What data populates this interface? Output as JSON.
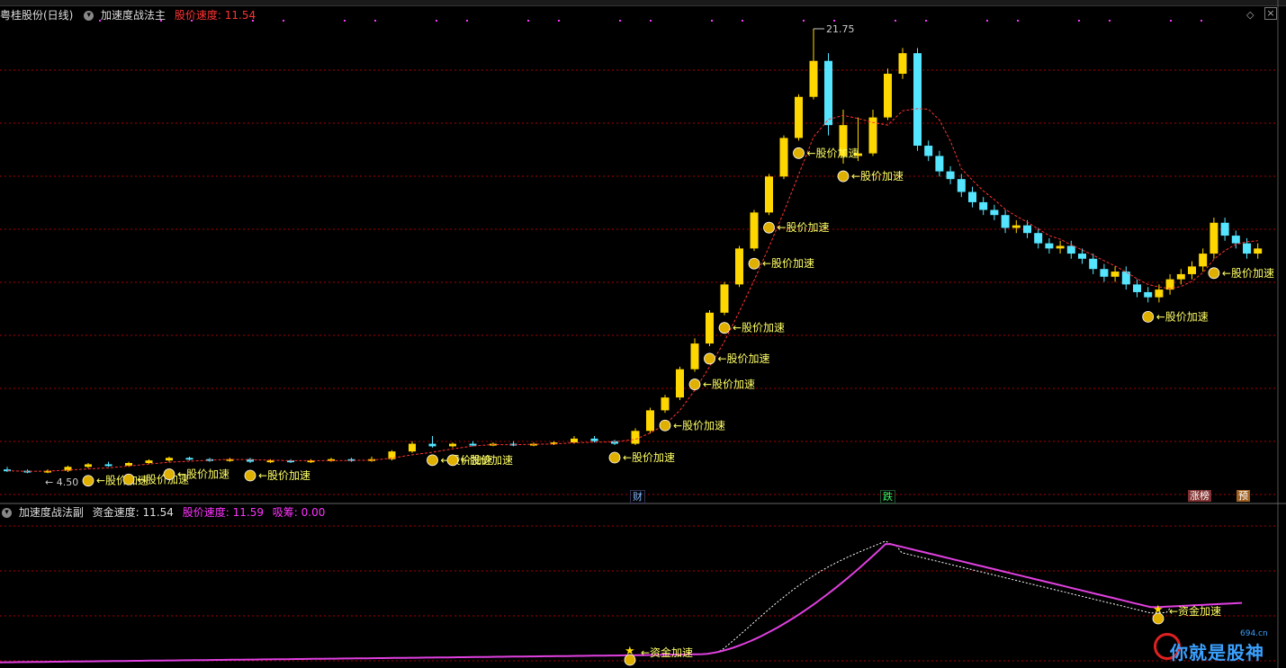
{
  "main_header": {
    "stock_name": "粤桂股份(日线)",
    "indicator_name": "加速度战法主",
    "speed_label": "股价速度:",
    "speed_value": "11.54"
  },
  "sub_header": {
    "indicator_name": "加速度战法副",
    "fund_speed_label": "资金速度:",
    "fund_speed_value": "11.54",
    "price_speed_label": "股价速度:",
    "price_speed_value": "11.59",
    "absorb_label": "吸筹:",
    "absorb_value": "0.00"
  },
  "chart_marks": {
    "high_label": "21.75",
    "low_label": "4.50",
    "signal_label": "股价加速",
    "fund_signal_label": "资金加速"
  },
  "event_tags": {
    "cai": "财",
    "die": "跌",
    "zhangbang": "涨榜",
    "yu": "预"
  },
  "watermark": {
    "url": "694.cn",
    "text": "你就是股神"
  },
  "colors": {
    "up": "#ffd700",
    "down": "#55e5ff",
    "ma": "#ff3333",
    "grid": "#aa0000",
    "signal_text": "#ffff66",
    "fund_line": "#e040e0",
    "fund_dashed": "#ffffff"
  },
  "chart_data": {
    "type": "candlestick",
    "title": "粤桂股份(日线)",
    "high": 21.75,
    "low": 4.5,
    "candles": [
      [
        4.6,
        4.55,
        4.7,
        4.5,
        "d"
      ],
      [
        4.55,
        4.5,
        4.6,
        4.45,
        "d"
      ],
      [
        4.5,
        4.55,
        4.6,
        4.45,
        "u"
      ],
      [
        4.55,
        4.7,
        4.75,
        4.5,
        "u"
      ],
      [
        4.7,
        4.8,
        4.85,
        4.65,
        "u"
      ],
      [
        4.8,
        4.75,
        4.9,
        4.7,
        "d"
      ],
      [
        4.75,
        4.85,
        4.9,
        4.7,
        "u"
      ],
      [
        4.85,
        4.95,
        5.0,
        4.8,
        "u"
      ],
      [
        4.95,
        5.05,
        5.1,
        4.9,
        "u"
      ],
      [
        5.05,
        5.0,
        5.1,
        4.95,
        "d"
      ],
      [
        5.0,
        4.95,
        5.05,
        4.9,
        "d"
      ],
      [
        4.95,
        5.0,
        5.05,
        4.9,
        "u"
      ],
      [
        5.0,
        4.9,
        5.05,
        4.85,
        "d"
      ],
      [
        4.9,
        4.95,
        5.0,
        4.85,
        "u"
      ],
      [
        4.95,
        4.9,
        5.0,
        4.85,
        "d"
      ],
      [
        4.9,
        4.95,
        5.0,
        4.85,
        "u"
      ],
      [
        4.95,
        5.0,
        5.05,
        4.9,
        "u"
      ],
      [
        5.0,
        4.95,
        5.05,
        4.9,
        "d"
      ],
      [
        4.95,
        5.0,
        5.1,
        4.9,
        "u"
      ],
      [
        5.0,
        5.3,
        5.35,
        4.95,
        "u"
      ],
      [
        5.3,
        5.6,
        5.7,
        5.25,
        "u"
      ],
      [
        5.6,
        5.5,
        5.9,
        5.45,
        "d"
      ],
      [
        5.5,
        5.6,
        5.65,
        5.45,
        "u"
      ],
      [
        5.6,
        5.55,
        5.7,
        5.5,
        "d"
      ],
      [
        5.55,
        5.6,
        5.65,
        5.5,
        "u"
      ],
      [
        5.6,
        5.55,
        5.7,
        5.5,
        "d"
      ],
      [
        5.55,
        5.6,
        5.65,
        5.5,
        "u"
      ],
      [
        5.6,
        5.65,
        5.7,
        5.55,
        "u"
      ],
      [
        5.65,
        5.8,
        5.9,
        5.6,
        "u"
      ],
      [
        5.8,
        5.7,
        5.9,
        5.65,
        "d"
      ],
      [
        5.7,
        5.6,
        5.75,
        5.55,
        "d"
      ],
      [
        5.6,
        6.1,
        6.2,
        5.55,
        "u"
      ],
      [
        6.1,
        6.9,
        7.0,
        6.0,
        "u"
      ],
      [
        6.9,
        7.4,
        7.5,
        6.8,
        "u"
      ],
      [
        7.4,
        8.5,
        8.6,
        7.3,
        "u"
      ],
      [
        8.5,
        9.5,
        9.7,
        8.4,
        "u"
      ],
      [
        9.5,
        10.7,
        10.8,
        9.4,
        "u"
      ],
      [
        10.7,
        11.8,
        11.9,
        10.6,
        "u"
      ],
      [
        11.8,
        13.2,
        13.3,
        11.7,
        "u"
      ],
      [
        13.2,
        14.6,
        14.7,
        13.1,
        "u"
      ],
      [
        14.6,
        16.0,
        16.1,
        14.5,
        "u"
      ],
      [
        16.0,
        17.5,
        17.6,
        15.9,
        "u"
      ],
      [
        17.5,
        19.1,
        19.2,
        17.4,
        "u"
      ],
      [
        19.1,
        20.5,
        21.75,
        19.0,
        "u"
      ],
      [
        20.5,
        18.0,
        20.8,
        17.6,
        "d"
      ],
      [
        18.0,
        16.8,
        18.6,
        16.5,
        "u"
      ],
      [
        16.8,
        16.9,
        18.3,
        16.6,
        "u"
      ],
      [
        16.9,
        18.3,
        18.6,
        16.8,
        "u"
      ],
      [
        18.3,
        20.0,
        20.2,
        18.2,
        "u"
      ],
      [
        20.0,
        20.8,
        21.0,
        19.8,
        "u"
      ],
      [
        20.8,
        17.2,
        21.0,
        17.0,
        "d"
      ]
    ]
  }
}
